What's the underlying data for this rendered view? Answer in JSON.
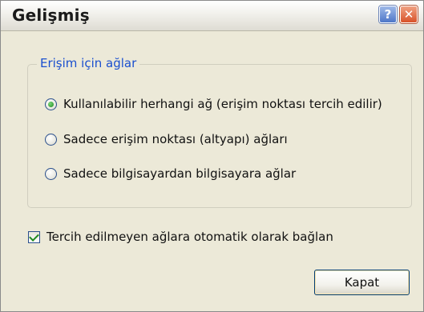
{
  "window": {
    "title": "Gelişmiş",
    "help_label": "?",
    "close_label": "✕"
  },
  "group": {
    "legend": "Erişim için ağlar",
    "options": [
      {
        "label": "Kullanılabilir herhangi ağ (erişim noktası tercih edilir)",
        "selected": true
      },
      {
        "label": "Sadece erişim noktası (altyapı) ağları",
        "selected": false
      },
      {
        "label": "Sadece bilgisayardan bilgisayara ağlar",
        "selected": false
      }
    ]
  },
  "auto_connect": {
    "label": "Tercih edilmeyen ağlara otomatik olarak bağlan",
    "checked": true
  },
  "buttons": {
    "close_label": "Kapat"
  },
  "colors": {
    "background": "#ECE9D8",
    "legend_text": "#1a4fcf",
    "button_border": "#003c74"
  }
}
